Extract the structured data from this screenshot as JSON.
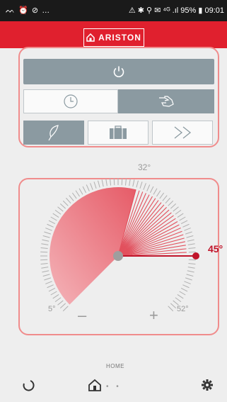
{
  "status_bar": {
    "left_icons": "ᨓ ⏰ ⊘ …",
    "right_text": "⚠ ✱ ⚲ ✉ ⁴ᴳ .ıl 95% ▮ 09:01",
    "battery": "95%",
    "time": "09:01"
  },
  "brand": {
    "name": "ARISTON",
    "color": "#e0202e"
  },
  "controls": {
    "power_icon": "power-icon",
    "schedule_icon": "clock-icon",
    "manual_icon": "hand-icon",
    "selected_mode": "manual",
    "modes": [
      {
        "icon": "leaf-icon",
        "active": true
      },
      {
        "icon": "suitcase-icon",
        "active": false
      },
      {
        "icon": "chevrons-right-icon",
        "active": false
      }
    ]
  },
  "dial": {
    "min_label": "5°",
    "max_label": "32°",
    "mid_label": "52°",
    "value_label": "45°",
    "minus_label": "–",
    "plus_label": "+",
    "accent": "#c0142a"
  },
  "nav": {
    "home_label": "HOME",
    "dots": "• •"
  }
}
